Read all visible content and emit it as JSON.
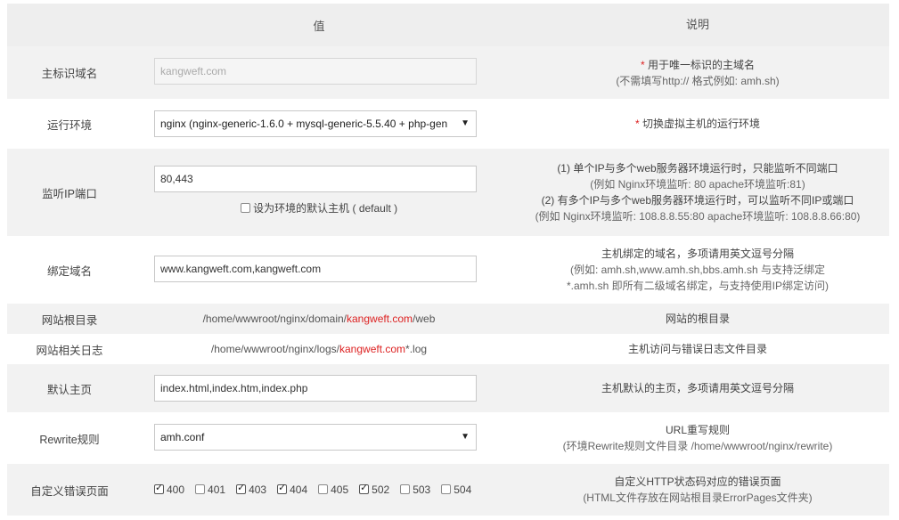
{
  "header": {
    "value": "值",
    "description": "说明"
  },
  "rows": {
    "domain": {
      "label": "主标识域名",
      "value": "kangweft.com",
      "desc_req": "*",
      "desc_main": " 用于唯一标识的主域名",
      "desc_sub": "(不需填写http:// 格式例如: amh.sh)"
    },
    "env": {
      "label": "运行环境",
      "value": "nginx (nginx-generic-1.6.0 + mysql-generic-5.5.40 + php-gen",
      "desc_req": "*",
      "desc_main": " 切换虚拟主机的运行环境"
    },
    "port": {
      "label": "监听IP端口",
      "value": "80,443",
      "default_label": "设为环境的默认主机 ( default )",
      "desc_1": "(1) 单个IP与多个web服务器环境运行时，只能监听不同端口",
      "desc_2": "(例如 Nginx环境监听: 80   apache环境监听:81)",
      "desc_3": "(2) 有多个IP与多个web服务器环境运行时，可以监听不同IP或端口",
      "desc_4": "(例如 Nginx环境监听: 108.8.8.55:80   apache环境监听: 108.8.8.66:80)"
    },
    "bind": {
      "label": "绑定域名",
      "value": "www.kangweft.com,kangweft.com",
      "desc_1": "主机绑定的域名，多项请用英文逗号分隔",
      "desc_2": "(例如: amh.sh,www.amh.sh,bbs.amh.sh 与支持泛绑定",
      "desc_3": "*.amh.sh 即所有二级域名绑定，与支持使用IP绑定访问)"
    },
    "root": {
      "label": "网站根目录",
      "path_pre": "/home/wwwroot/nginx/domain/",
      "path_red": "kangweft.com",
      "path_post": "/web",
      "desc": "网站的根目录"
    },
    "log": {
      "label": "网站相关日志",
      "path_pre": "/home/wwwroot/nginx/logs/",
      "path_red": "kangweft.com",
      "path_post": "*.log",
      "desc": "主机访问与错误日志文件目录"
    },
    "index": {
      "label": "默认主页",
      "value": "index.html,index.htm,index.php",
      "desc": "主机默认的主页，多项请用英文逗号分隔"
    },
    "rewrite": {
      "label": "Rewrite规则",
      "value": "amh.conf",
      "desc_1": "URL重写规则",
      "desc_2": "(环境Rewrite规则文件目录 /home/wwwroot/nginx/rewrite)"
    },
    "errors": {
      "label": "自定义错误页面",
      "codes": [
        {
          "code": "400",
          "checked": true
        },
        {
          "code": "401",
          "checked": false
        },
        {
          "code": "403",
          "checked": true
        },
        {
          "code": "404",
          "checked": true
        },
        {
          "code": "405",
          "checked": false
        },
        {
          "code": "502",
          "checked": true
        },
        {
          "code": "503",
          "checked": false
        },
        {
          "code": "504",
          "checked": false
        }
      ],
      "desc_1": "自定义HTTP状态码对应的错误页面",
      "desc_2": "(HTML文件存放在网站根目录ErrorPages文件夹)"
    }
  },
  "colors": {
    "accent_red": "#dd2222",
    "row_alt": "#f2f2f2",
    "header_bg": "#eeeeee"
  }
}
